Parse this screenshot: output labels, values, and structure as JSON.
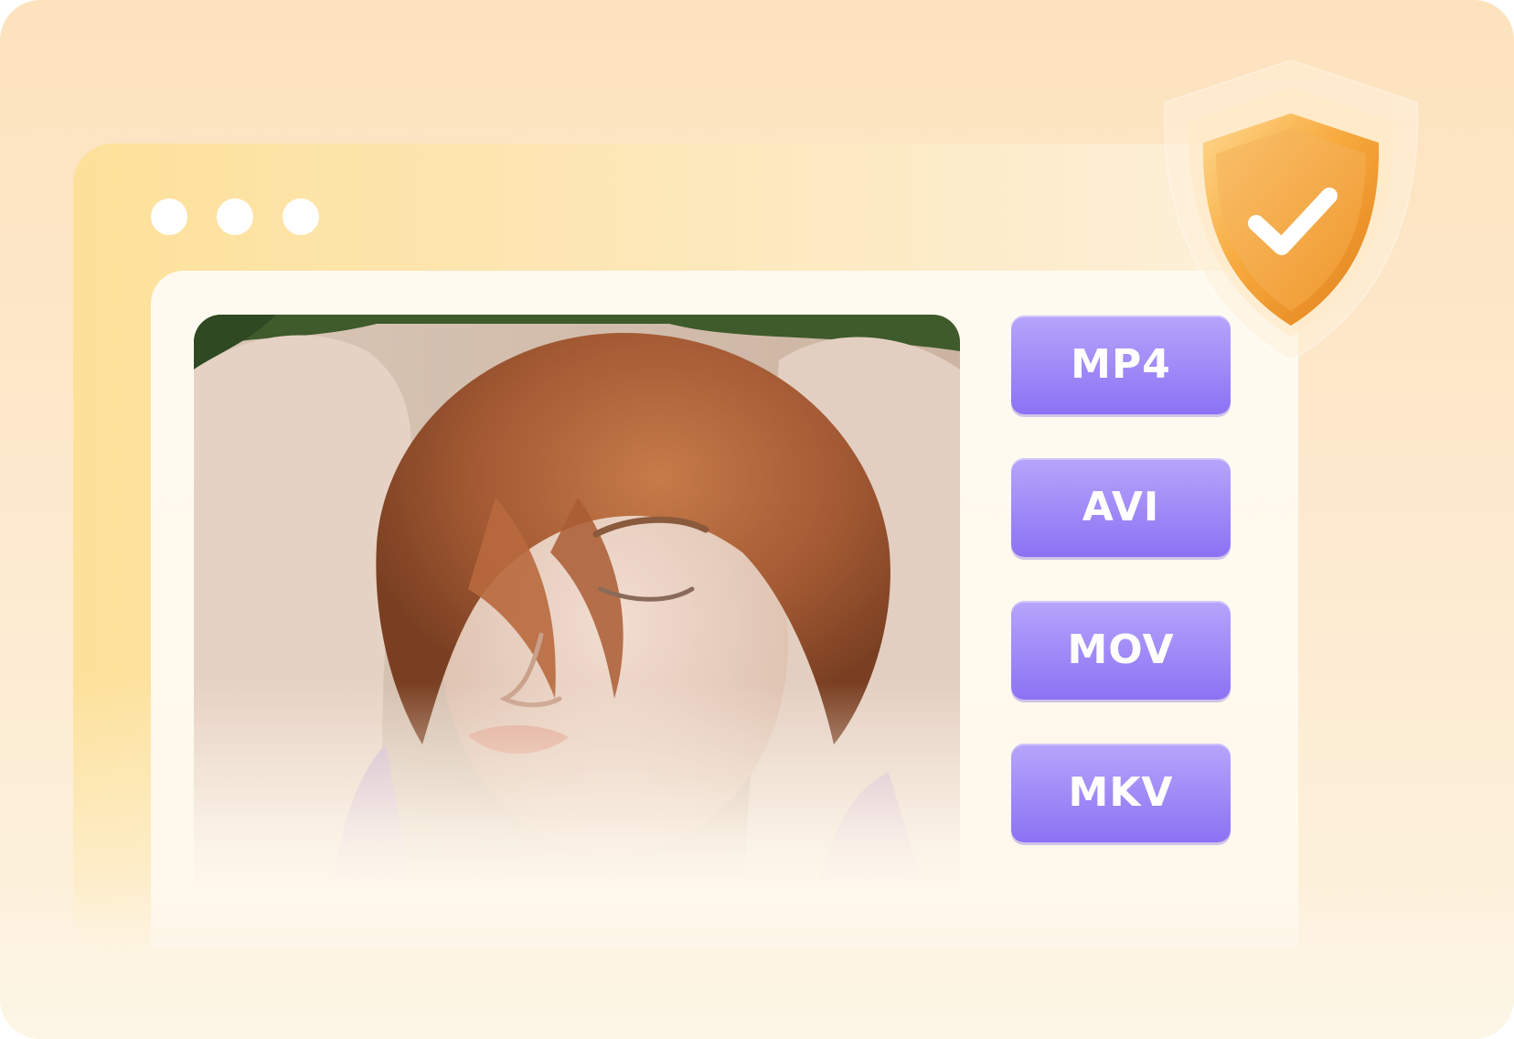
{
  "window": {
    "controls": [
      "window-dot",
      "window-dot",
      "window-dot"
    ]
  },
  "preview": {
    "image_icon": "portrait-photo"
  },
  "formats": {
    "items": [
      {
        "label": "MP4"
      },
      {
        "label": "AVI"
      },
      {
        "label": "MOV"
      },
      {
        "label": "MKV"
      }
    ],
    "button_color_top": "#b6a5fb",
    "button_color_bottom": "#8c72f4"
  },
  "badge": {
    "icon": "shield-check-icon",
    "color": "#f5b24e"
  },
  "colors": {
    "background": "#fde6c4",
    "window": "#fde19a",
    "panel": "#fff8ec"
  }
}
